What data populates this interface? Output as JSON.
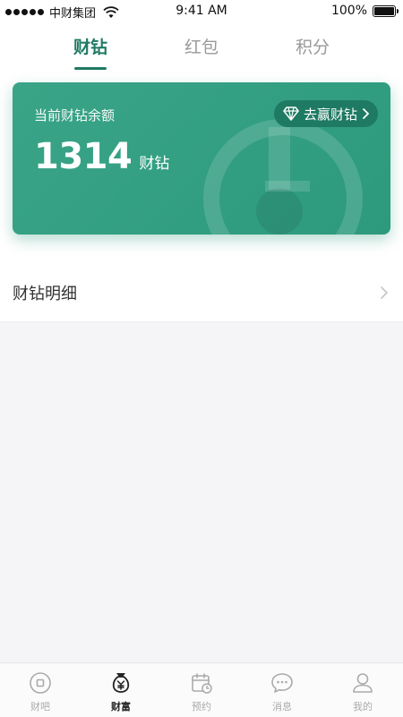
{
  "status_bar": {
    "carrier": "中财集团",
    "time": "9:41 AM",
    "battery": "100%",
    "battery_level": 1.0
  },
  "tabs": [
    {
      "label": "财钻",
      "active": true
    },
    {
      "label": "红包",
      "active": false
    },
    {
      "label": "积分",
      "active": false
    }
  ],
  "balance_card": {
    "label": "当前财钻余额",
    "amount": "1314",
    "unit": "财钻",
    "earn_button": "去赢财钻",
    "colors": {
      "bg": "#2d9a7d",
      "button": "#1f7a63"
    }
  },
  "detail": {
    "label": "财钻明细"
  },
  "bottom_nav": [
    {
      "label": "财吧",
      "icon": "coin-icon",
      "active": false
    },
    {
      "label": "财富",
      "icon": "money-bag-icon",
      "active": true
    },
    {
      "label": "预约",
      "icon": "calendar-icon",
      "active": false
    },
    {
      "label": "消息",
      "icon": "chat-icon",
      "active": false
    },
    {
      "label": "我的",
      "icon": "user-icon",
      "active": false
    }
  ]
}
